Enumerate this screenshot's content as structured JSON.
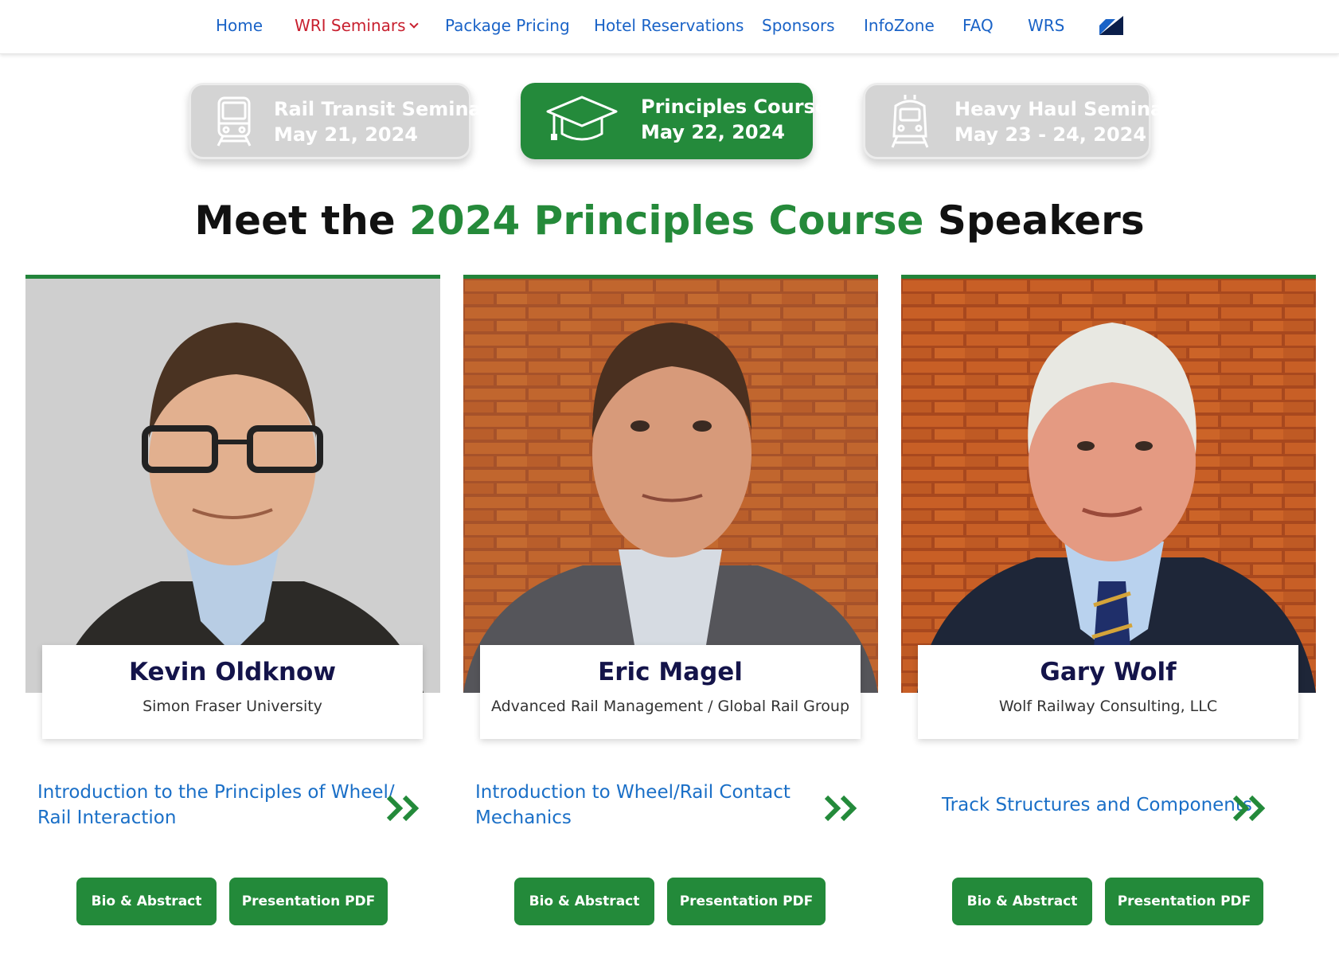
{
  "nav": {
    "items": [
      "Home",
      "WRI Seminars",
      "Package Pricing",
      "Hotel Reservations",
      "Sponsors",
      "InfoZone",
      "FAQ",
      "WRS"
    ],
    "active_color": "#c8202f",
    "link_color": "#1a63c7"
  },
  "tabs": [
    {
      "title": "Rail Transit Seminar",
      "date": "May 21, 2024",
      "icon": "tram-icon",
      "active": false
    },
    {
      "title": "Principles Course",
      "date": "May 22, 2024",
      "icon": "graduation-cap-icon",
      "active": true
    },
    {
      "title": "Heavy Haul Seminar",
      "date": "May 23 - 24, 2024",
      "icon": "locomotive-icon",
      "active": false
    }
  ],
  "heading": {
    "prefix": "Meet the ",
    "highlight": "2024 Principles Course",
    "suffix": " Speakers"
  },
  "speakers": [
    {
      "name": "Kevin Oldknow",
      "org": "Simon Fraser University",
      "talk": "Introduction to the Principles of Wheel/ Rail Interaction",
      "talk_line1": "Introduction to the Principles of Wheel/",
      "talk_line2": "Rail Interaction"
    },
    {
      "name": "Eric Magel",
      "org": "Advanced Rail Management / Global Rail Group",
      "talk": "Introduction to Wheel/Rail Contact Mechanics",
      "talk_line1": "Introduction to Wheel/Rail Contact",
      "talk_line2": "Mechanics"
    },
    {
      "name": "Gary Wolf",
      "org": "Wolf Railway Consulting, LLC",
      "talk": "Track Structures and Components",
      "talk_line1": "Track Structures and Components",
      "talk_line2": ""
    }
  ],
  "buttons": {
    "bio": "Bio & Abstract",
    "pdf": "Presentation PDF"
  },
  "colors": {
    "green": "#248a3b",
    "inactive_tab": "#d4d4d4",
    "name": "#14144a",
    "talk_link": "#1a6fc7"
  }
}
